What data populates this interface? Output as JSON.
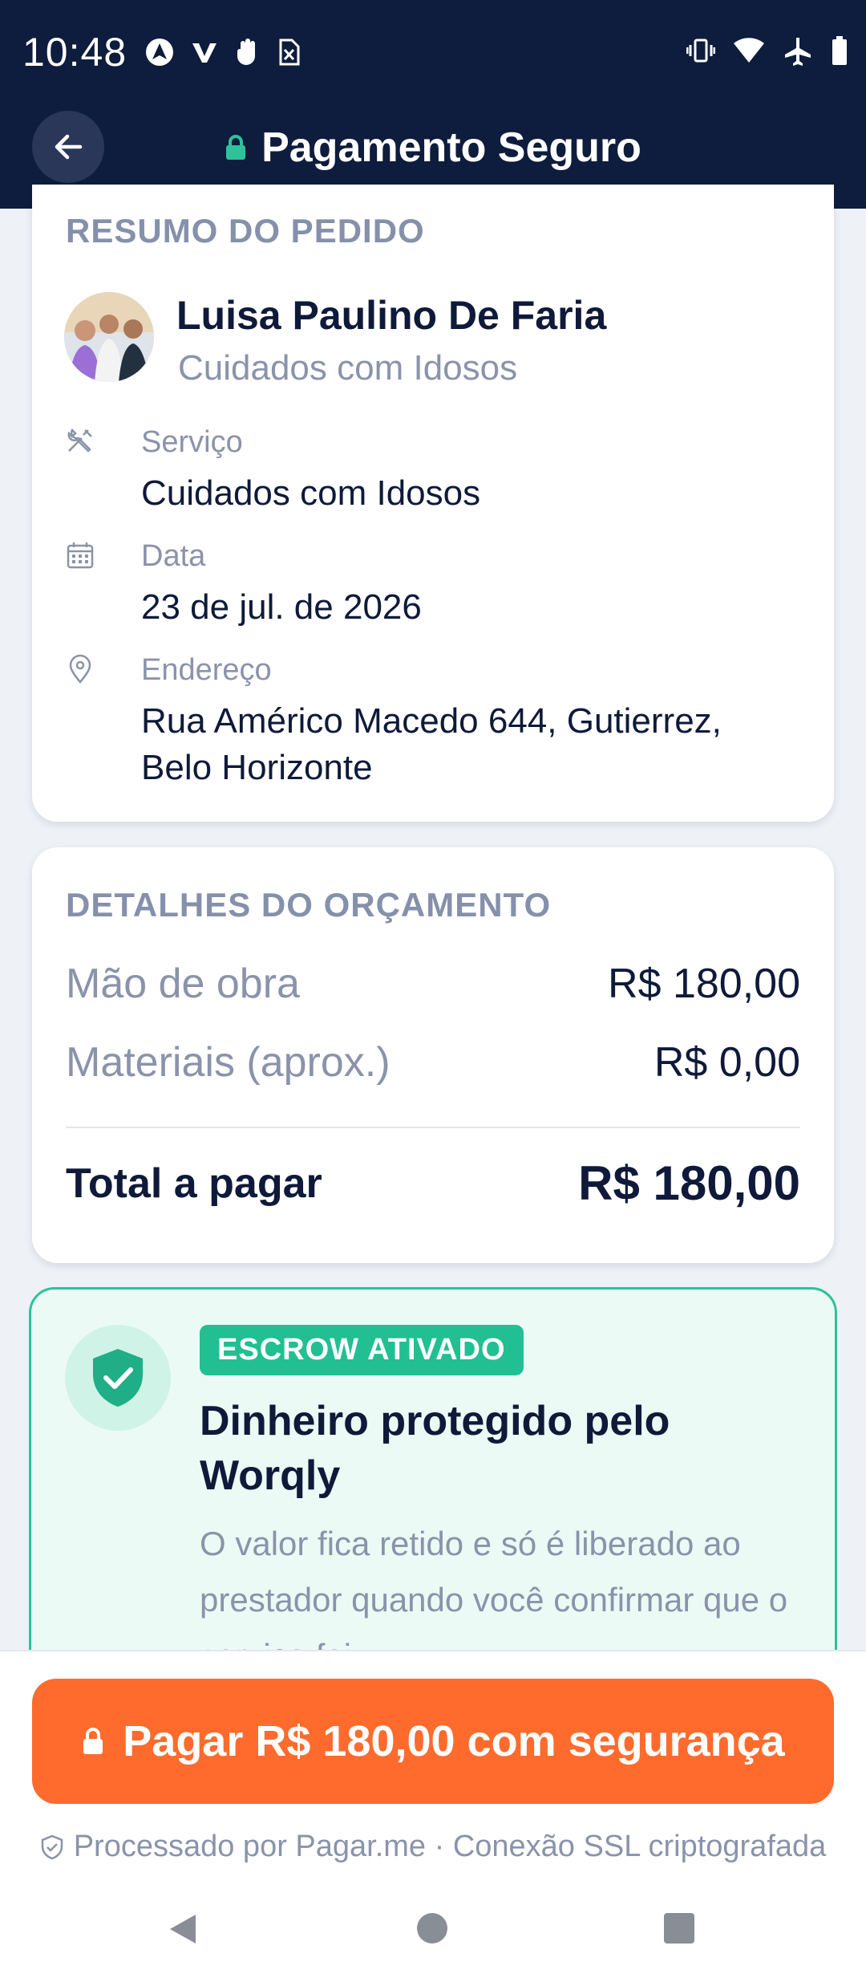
{
  "status_bar": {
    "time": "10:48",
    "notification_icons": [
      "android-auto-icon",
      "v-app-icon",
      "hand-icon",
      "sim-off-icon"
    ],
    "system_icons": [
      "vibrate-icon",
      "wifi-icon",
      "airplane-icon",
      "battery-icon"
    ]
  },
  "appbar": {
    "title": "Pagamento Seguro"
  },
  "summary": {
    "section_title": "RESUMO DO PEDIDO",
    "provider_name": "Luisa Paulino De Faria",
    "provider_category": "Cuidados com Idosos",
    "service_label": "Serviço",
    "service_value": "Cuidados com Idosos",
    "date_label": "Data",
    "date_value": "23 de jul. de 2026",
    "address_label": "Endereço",
    "address_line1": "Rua Américo Macedo 644, Gutierrez,",
    "address_line2": "Belo Horizonte"
  },
  "budget": {
    "section_title": "DETALHES DO ORÇAMENTO",
    "labor_label": "Mão de obra",
    "labor_value": "R$ 180,00",
    "materials_label": "Materiais (aprox.)",
    "materials_value": "R$ 0,00",
    "total_label": "Total a pagar",
    "total_value": "R$ 180,00"
  },
  "escrow": {
    "badge": "ESCROW ATIVADO",
    "title": "Dinheiro protegido pelo Worqly",
    "description": "O valor fica retido e só é liberado ao prestador quando você confirmar que o serviço foi"
  },
  "footer": {
    "pay_button": "Pagar R$ 180,00 com segurança",
    "secure_note": "Processado por Pagar.me · Conexão SSL criptografada"
  },
  "colors": {
    "header_bg": "#0e1c3d",
    "accent_orange": "#ff6b2c",
    "escrow_green": "#22bf93",
    "muted_text": "#8a93aa"
  }
}
